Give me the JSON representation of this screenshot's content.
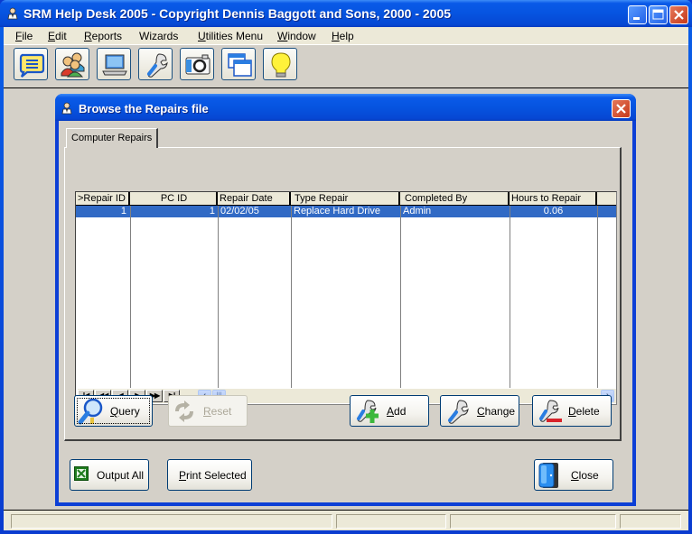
{
  "app": {
    "title": "SRM Help Desk 2005 - Copyright Dennis Baggott and Sons, 2000 - 2005",
    "window_controls": [
      "minimize",
      "maximize",
      "close"
    ]
  },
  "menu": [
    {
      "label": "File",
      "accel": "F",
      "rest": "ile"
    },
    {
      "label": "Edit",
      "accel": "E",
      "rest": "dit"
    },
    {
      "label": "Reports",
      "accel": "R",
      "rest": "eports"
    },
    {
      "label": "Wizards",
      "accel": "",
      "rest": "Wizards"
    },
    {
      "label": "Utilities Menu",
      "accel": "U",
      "rest": "tilities Menu"
    },
    {
      "label": "Window",
      "accel": "W",
      "rest": "indow"
    },
    {
      "label": "Help",
      "accel": "H",
      "rest": "elp"
    }
  ],
  "toolbar": [
    {
      "icon": "chat-list-icon",
      "name": "messages"
    },
    {
      "icon": "users-icon",
      "name": "users"
    },
    {
      "icon": "laptop-icon",
      "name": "computers"
    },
    {
      "icon": "wrench-icon",
      "name": "repairs"
    },
    {
      "icon": "camera-icon",
      "name": "camera"
    },
    {
      "icon": "windows-icon",
      "name": "windows"
    },
    {
      "icon": "lightbulb-icon",
      "name": "tips"
    }
  ],
  "dialog": {
    "title": "Browse the Repairs file",
    "tab": "Computer Repairs",
    "grid": {
      "columns": [
        ">Repair ID",
        "PC ID",
        "Repair Date",
        "Type Repair",
        "Completed By",
        "Hours to Repair"
      ],
      "rows": [
        {
          "repair_id": "1",
          "pc_id": "1",
          "repair_date": "02/02/05",
          "type_repair": "Replace Hard Drive",
          "completed_by": "Admin",
          "hours": "0.06",
          "selected": true
        }
      ],
      "nav": [
        "first",
        "prev-page",
        "prev",
        "next",
        "next-page",
        "last"
      ],
      "nav_glyphs": [
        "I◀",
        "◀◀",
        "◀",
        "▶",
        "▶▶",
        "▶I"
      ]
    },
    "buttons": {
      "query": {
        "accel": "Q",
        "rest": "uery"
      },
      "reset": {
        "accel": "R",
        "rest": "eset",
        "disabled": true
      },
      "add": {
        "accel": "A",
        "rest": "dd"
      },
      "change": {
        "accel": "C",
        "rest": "hange"
      },
      "delete": {
        "accel": "D",
        "rest": "elete"
      },
      "output_all": {
        "label": "Output All"
      },
      "print_selected": {
        "accel": "P",
        "rest": "rint Selected"
      },
      "close": {
        "accel": "C",
        "rest": "lose"
      }
    }
  },
  "statusbar": {
    "panes": [
      "",
      "",
      "",
      ""
    ]
  },
  "colors": {
    "titlebar": "#0654e0",
    "selection": "#316ac5",
    "face": "#d4d0c8",
    "menu": "#ece9d8"
  }
}
